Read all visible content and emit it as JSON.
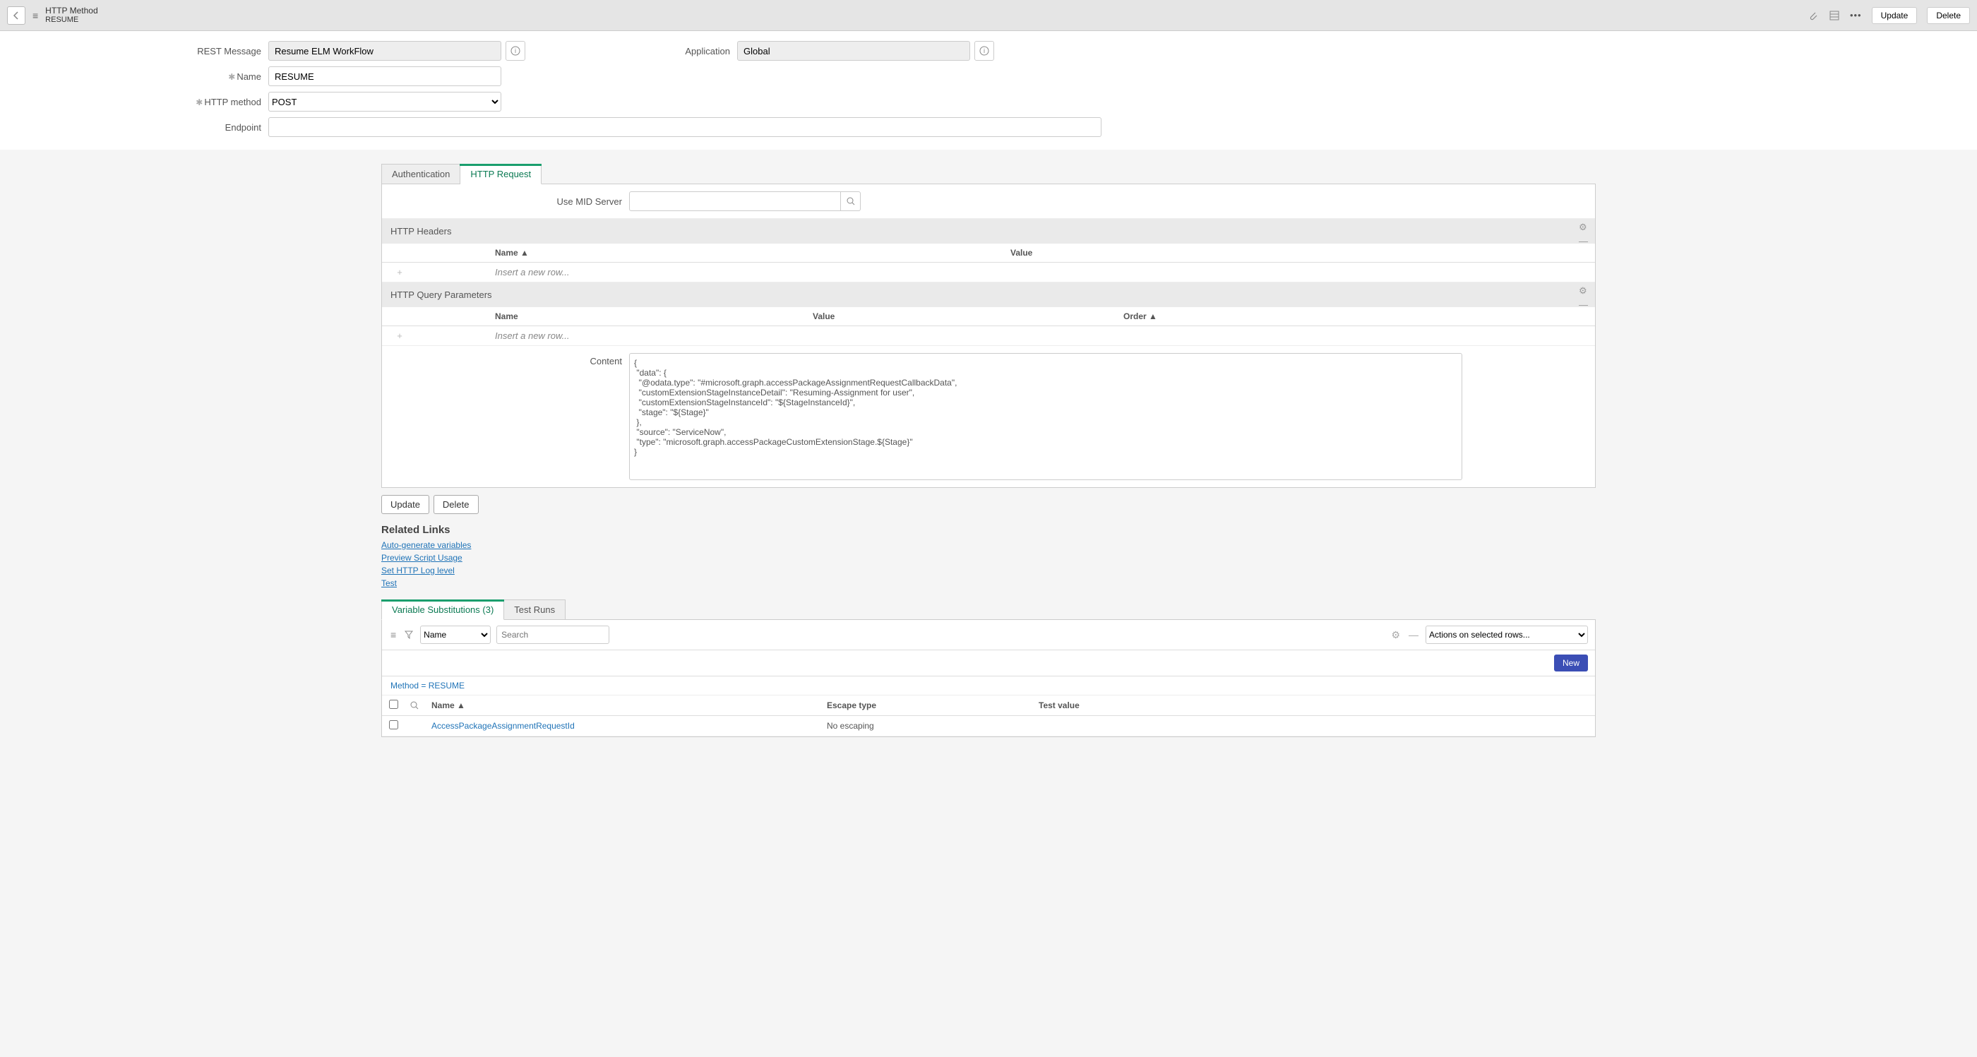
{
  "header": {
    "title_line1": "HTTP Method",
    "title_line2": "RESUME",
    "update_btn": "Update",
    "delete_btn": "Delete"
  },
  "form": {
    "rest_message_label": "REST Message",
    "rest_message_value": "Resume ELM WorkFlow",
    "application_label": "Application",
    "application_value": "Global",
    "name_label": "Name",
    "name_value": "RESUME",
    "http_method_label": "HTTP method",
    "http_method_value": "POST",
    "endpoint_label": "Endpoint",
    "endpoint_value": ""
  },
  "tabs": {
    "auth": "Authentication",
    "http_request": "HTTP Request"
  },
  "mid": {
    "label": "Use MID Server",
    "value": ""
  },
  "headers_section": {
    "title": "HTTP Headers",
    "col_name": "Name",
    "col_value": "Value",
    "insert_placeholder": "Insert a new row..."
  },
  "query_section": {
    "title": "HTTP Query Parameters",
    "col_name": "Name",
    "col_value": "Value",
    "col_order": "Order",
    "insert_placeholder": "Insert a new row..."
  },
  "content_section": {
    "label": "Content",
    "value": "{\n \"data\": {\n  \"@odata.type\": \"#microsoft.graph.accessPackageAssignmentRequestCallbackData\",\n  \"customExtensionStageInstanceDetail\": \"Resuming-Assignment for user\",\n  \"customExtensionStageInstanceId\": \"${StageInstanceId}\",\n  \"stage\": \"${Stage}\"\n },\n \"source\": \"ServiceNow\",\n \"type\": \"microsoft.graph.accessPackageCustomExtensionStage.${Stage}\"\n}"
  },
  "action_buttons": {
    "update": "Update",
    "delete": "Delete"
  },
  "related_links": {
    "heading": "Related Links",
    "link1": "Auto-generate variables",
    "link2": "Preview Script Usage",
    "link3": "Set HTTP Log level",
    "link4": "Test"
  },
  "var_tabs": {
    "subs": "Variable Substitutions (3)",
    "test_runs": "Test Runs"
  },
  "var_list": {
    "search_field": "Name",
    "search_placeholder": "Search",
    "actions_label": "Actions on selected rows...",
    "new_btn": "New",
    "breadcrumb": "Method = RESUME",
    "col_name": "Name",
    "col_escape": "Escape type",
    "col_test": "Test value",
    "rows": [
      {
        "name": "AccessPackageAssignmentRequestId",
        "escape": "No escaping",
        "test": ""
      }
    ]
  }
}
